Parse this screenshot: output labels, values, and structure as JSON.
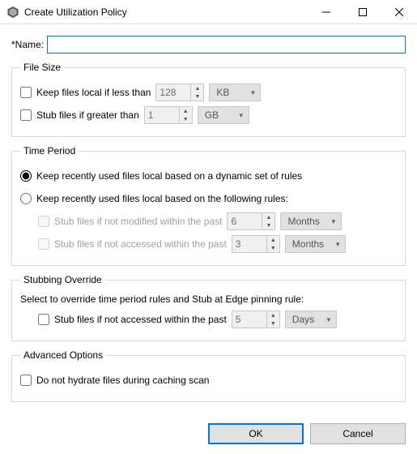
{
  "window": {
    "title": "Create Utilization Policy"
  },
  "name": {
    "label": "*Name:",
    "value": ""
  },
  "fileSize": {
    "legend": "File Size",
    "keepLocal": {
      "label": "Keep files local if less than",
      "checked": false,
      "value": "128",
      "unit": "KB"
    },
    "stubGreater": {
      "label": "Stub files if greater than",
      "checked": false,
      "value": "1",
      "unit": "GB"
    }
  },
  "timePeriod": {
    "legend": "Time Period",
    "optDynamic": "Keep recently used files local based on a dynamic set of rules",
    "optRules": "Keep recently used files local based on the following rules:",
    "selected": "dynamic",
    "notModified": {
      "label": "Stub files if not modified within the past",
      "checked": false,
      "value": "6",
      "unit": "Months"
    },
    "notAccessed": {
      "label": "Stub files if not accessed within the past",
      "checked": false,
      "value": "3",
      "unit": "Months"
    }
  },
  "override": {
    "legend": "Stubbing Override",
    "desc": "Select to override time period rules and Stub at Edge pinning rule:",
    "notAccessed": {
      "label": "Stub files if not accessed within the past",
      "checked": false,
      "value": "5",
      "unit": "Days"
    }
  },
  "advanced": {
    "legend": "Advanced Options",
    "noHydrate": {
      "label": "Do not hydrate files during caching scan",
      "checked": false
    }
  },
  "buttons": {
    "ok": "OK",
    "cancel": "Cancel"
  }
}
